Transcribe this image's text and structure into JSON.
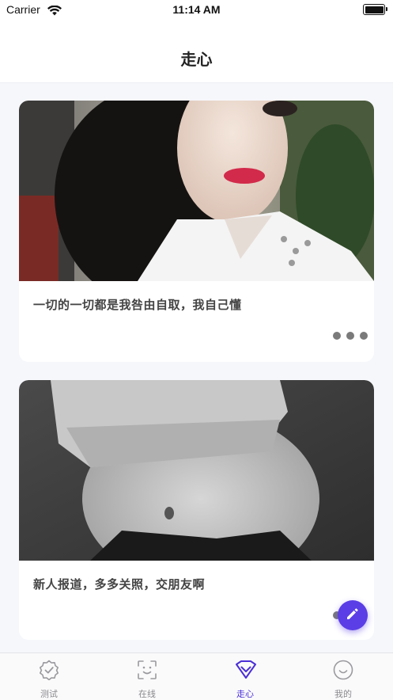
{
  "status_bar": {
    "carrier": "Carrier",
    "time": "11:14 AM"
  },
  "nav": {
    "title": "走心"
  },
  "posts": [
    {
      "caption": "一切的一切都是我咎由自取，我自己懂"
    },
    {
      "caption": "新人报道，多多关照，交朋友啊"
    }
  ],
  "tabs": [
    {
      "label": "测试",
      "icon": "badge-check-icon"
    },
    {
      "label": "在线",
      "icon": "face-scan-icon"
    },
    {
      "label": "走心",
      "icon": "heart-diamond-icon",
      "active": true
    },
    {
      "label": "我的",
      "icon": "smiley-icon"
    }
  ],
  "colors": {
    "accent": "#5b3ee6",
    "active_tab": "#4b2fd6",
    "inactive_tab": "#8a8a8e",
    "background": "#f6f7fb"
  }
}
